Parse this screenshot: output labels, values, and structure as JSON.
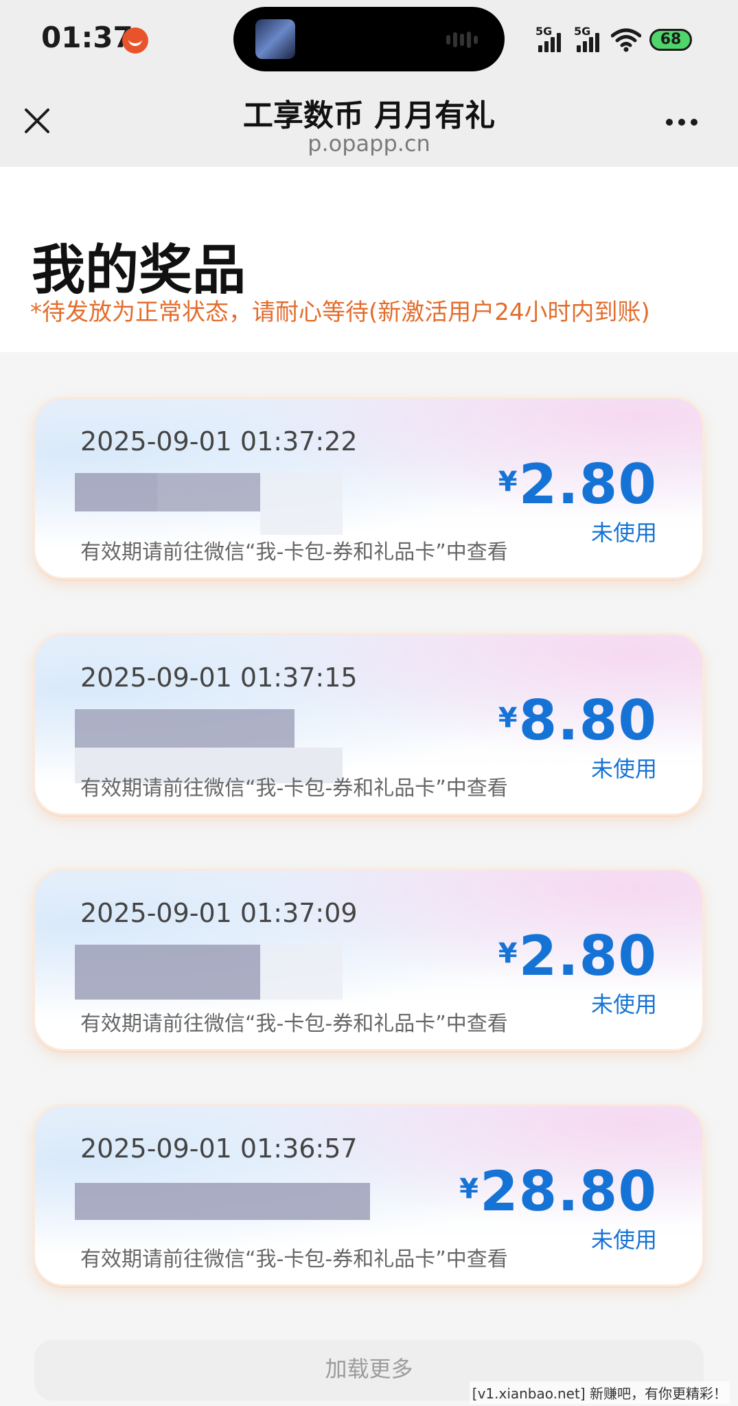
{
  "status_bar": {
    "time": "01:37",
    "signal1": "5G",
    "signal2": "5G",
    "battery": "68"
  },
  "nav": {
    "title": "工享数币 月月有礼",
    "url": "p.opapp.cn"
  },
  "header": {
    "title": "我的奖品",
    "notice": "*待发放为正常状态，请耐心等待(新激活用户24小时内到账)"
  },
  "cards": [
    {
      "date": "2025-09-01 01:37:22",
      "currency": "¥",
      "amount": "2.80",
      "status": "未使用",
      "hint": "有效期请前往微信“我-卡包-券和礼品卡”中查看"
    },
    {
      "date": "2025-09-01 01:37:15",
      "currency": "¥",
      "amount": "8.80",
      "status": "未使用",
      "hint": "有效期请前往微信“我-卡包-券和礼品卡”中查看"
    },
    {
      "date": "2025-09-01 01:37:09",
      "currency": "¥",
      "amount": "2.80",
      "status": "未使用",
      "hint": "有效期请前往微信“我-卡包-券和礼品卡”中查看"
    },
    {
      "date": "2025-09-01 01:36:57",
      "currency": "¥",
      "amount": "28.80",
      "status": "未使用",
      "hint": "有效期请前往微信“我-卡包-券和礼品卡”中查看"
    }
  ],
  "load_more": "加载更多",
  "watermark": "[v1.xianbao.net] 新赚吧，有你更精彩！",
  "colors": {
    "accent_blue": "#1673d6",
    "notice_orange": "#e36c2c",
    "page_bg": "#f5f5f5"
  },
  "icons": [
    "close-icon",
    "more-icon",
    "wifi-icon",
    "battery-icon",
    "signal-icon"
  ]
}
